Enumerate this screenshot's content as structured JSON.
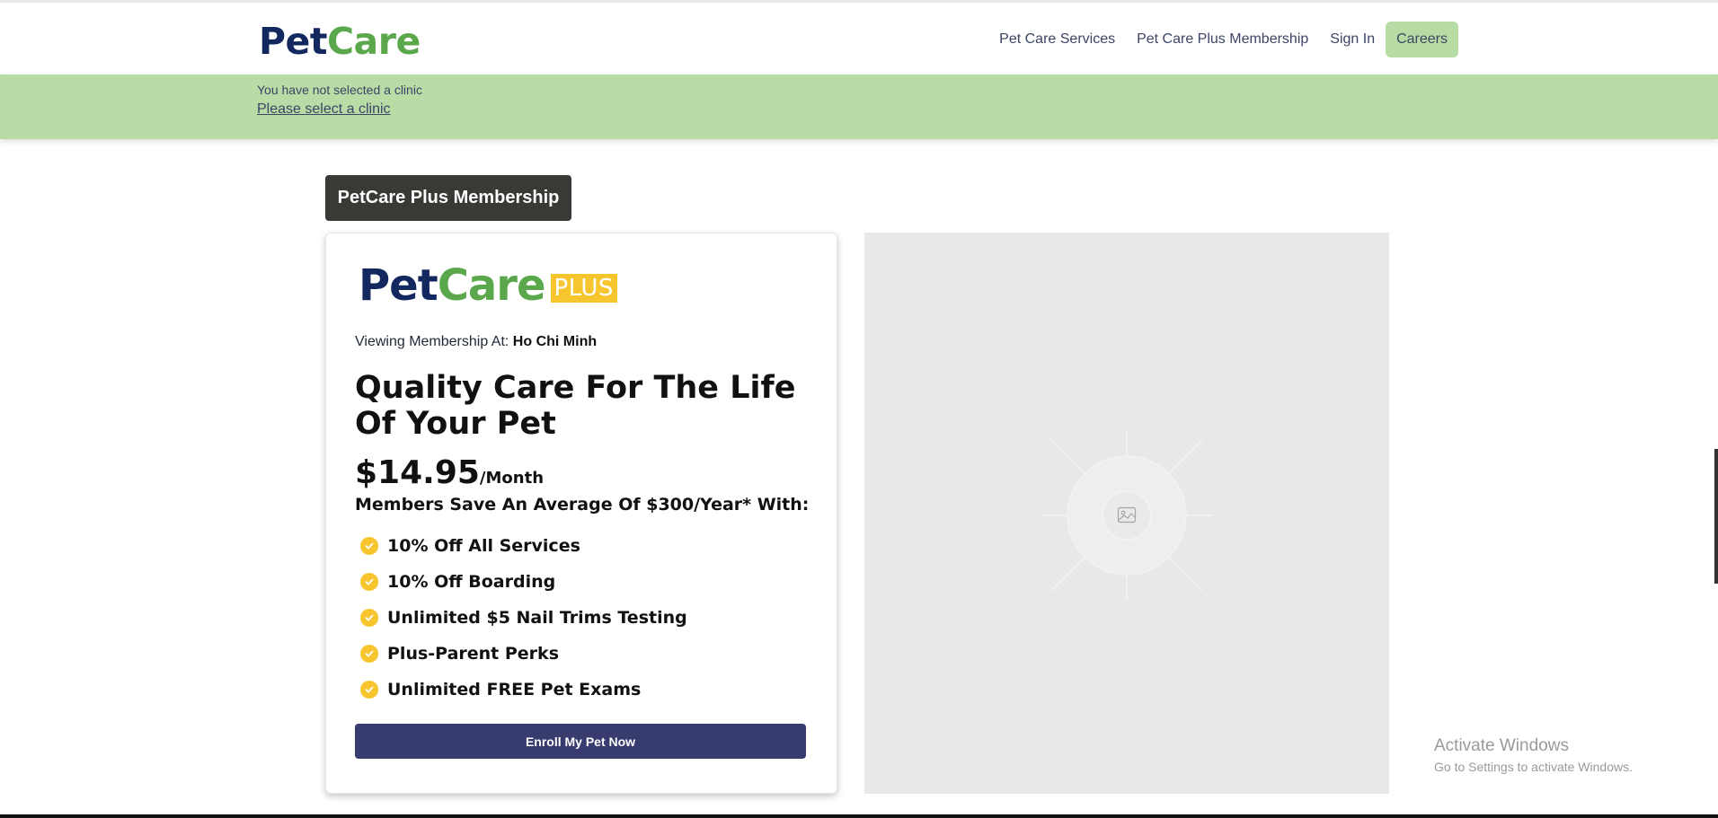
{
  "header": {
    "logo_pet": "Pet",
    "logo_care": "Care",
    "nav": [
      "Pet Care Services",
      "Pet Care Plus Membership",
      "Sign In"
    ],
    "careers": "Careers"
  },
  "banner": {
    "message": "You have not selected a clinic",
    "link": "Please select a clinic"
  },
  "membership": {
    "tag": "PetCare Plus Membership",
    "logo_pet": "Pet",
    "logo_care": "Care",
    "logo_plus": "PLUS",
    "viewing_label": "Viewing Membership At: ",
    "viewing_location": "Ho Chi Minh",
    "headline": "Quality Care For The Life Of Your Pet",
    "price": "$14.95",
    "price_unit": "/Month",
    "savings": "Members Save An Average Of $300/Year* With:",
    "benefits": [
      "10% Off All Services",
      "10% Off Boarding",
      "Unlimited $5 Nail Trims Testing",
      "Plus-Parent Perks",
      "Unlimited FREE Pet Exams"
    ],
    "enroll": "Enroll My Pet Now"
  },
  "watermark": {
    "line1": "Activate Windows",
    "line2": "Go to Settings to activate Windows."
  },
  "colors": {
    "navy": "#13285f",
    "green": "#5aa84b",
    "banner": "#b8dca5",
    "plus_yellow": "#f7c62f",
    "button": "#383b6e"
  },
  "icons": {
    "benefit": "check-circle-icon",
    "placeholder": "image-icon"
  }
}
